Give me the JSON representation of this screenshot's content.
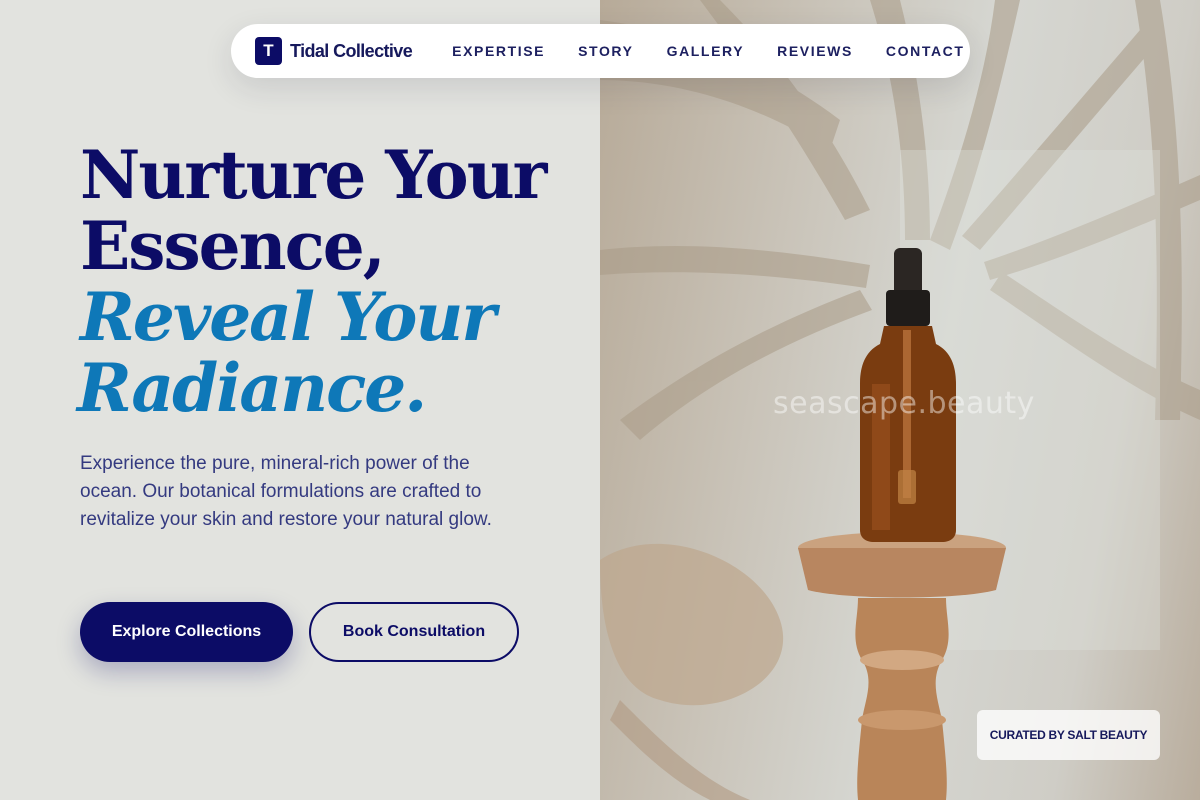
{
  "nav": {
    "brand_initial": "T",
    "brand_name": "Tidal Collective",
    "links": [
      "EXPERTISE",
      "STORY",
      "GALLERY",
      "REVIEWS",
      "CONTACT"
    ]
  },
  "hero": {
    "headline_line1": "Nurture Your",
    "headline_line2": "Essence,",
    "headline_line3": "Reveal Your",
    "headline_line4": "Radiance.",
    "lead": "Experience the pure, mineral-rich power of the ocean. Our botanical formulations are crafted to revitalize your skin and restore your natural glow.",
    "primary_cta": "Explore Collections",
    "secondary_cta": "Book Consultation"
  },
  "image": {
    "watermark": "seascape.beauty",
    "badge": "CURATED BY SALT BEAUTY"
  },
  "colors": {
    "navy": "#0c0c66",
    "accent_blue": "#0e78b8",
    "background": "#e2e3df"
  }
}
